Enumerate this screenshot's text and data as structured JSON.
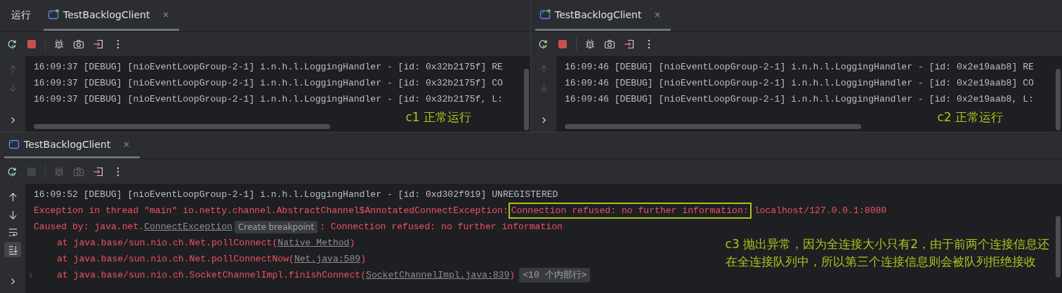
{
  "panels": [
    {
      "kind": "split",
      "run_label": "运行",
      "tab": {
        "title": "TestBacklogClient",
        "selected": true,
        "running": true
      },
      "toolbar": [
        {
          "kind": "rerun",
          "disabled": false
        },
        {
          "kind": "stop",
          "disabled": false
        },
        {
          "kind": "debug",
          "disabled": false
        },
        {
          "kind": "camera",
          "disabled": false
        },
        {
          "kind": "exit",
          "disabled": false
        },
        {
          "kind": "more",
          "disabled": false
        }
      ],
      "gutter": [
        {
          "kind": "up",
          "disabled": true
        },
        {
          "kind": "down",
          "disabled": true
        },
        {
          "kind": "chevron",
          "disabled": false,
          "selected": false
        }
      ],
      "lines": [
        {
          "kind": "debug",
          "segments": [
            {
              "kind": "text",
              "text": "16:09:37 [DEBUG] [nioEventLoopGroup-2-1] i.n.h.l.LoggingHandler - [id: 0x32b2175f] RE"
            }
          ]
        },
        {
          "kind": "debug",
          "segments": [
            {
              "kind": "text",
              "text": "16:09:37 [DEBUG] [nioEventLoopGroup-2-1] i.n.h.l.LoggingHandler - [id: 0x32b2175f] CO"
            }
          ]
        },
        {
          "kind": "debug",
          "segments": [
            {
              "kind": "text",
              "text": "16:09:37 [DEBUG] [nioEventLoopGroup-2-1] i.n.h.l.LoggingHandler - [id: 0x32b2175f, L:"
            }
          ]
        }
      ],
      "annotation": [
        "c1 正常运行"
      ]
    },
    {
      "kind": "split",
      "tab": {
        "title": "TestBacklogClient",
        "selected": true,
        "running": true
      },
      "toolbar": [
        {
          "kind": "rerun",
          "disabled": false
        },
        {
          "kind": "stop",
          "disabled": false
        },
        {
          "kind": "debug",
          "disabled": false
        },
        {
          "kind": "camera",
          "disabled": false
        },
        {
          "kind": "exit",
          "disabled": false
        },
        {
          "kind": "more",
          "disabled": false
        }
      ],
      "gutter": [
        {
          "kind": "up",
          "disabled": true
        },
        {
          "kind": "down",
          "disabled": true
        },
        {
          "kind": "chevron",
          "disabled": false,
          "selected": false
        }
      ],
      "lines": [
        {
          "kind": "debug",
          "segments": [
            {
              "kind": "text",
              "text": "16:09:46 [DEBUG] [nioEventLoopGroup-2-1] i.n.h.l.LoggingHandler - [id: 0x2e19aab8] RE"
            }
          ]
        },
        {
          "kind": "debug",
          "segments": [
            {
              "kind": "text",
              "text": "16:09:46 [DEBUG] [nioEventLoopGroup-2-1] i.n.h.l.LoggingHandler - [id: 0x2e19aab8] CO"
            }
          ]
        },
        {
          "kind": "debug",
          "segments": [
            {
              "kind": "text",
              "text": "16:09:46 [DEBUG] [nioEventLoopGroup-2-1] i.n.h.l.LoggingHandler - [id: 0x2e19aab8, L:"
            }
          ]
        }
      ],
      "annotation": [
        "c2 正常运行"
      ]
    },
    {
      "kind": "full",
      "tab": {
        "title": "TestBacklogClient",
        "selected": true,
        "running": false
      },
      "toolbar": [
        {
          "kind": "rerun",
          "disabled": false
        },
        {
          "kind": "stop",
          "disabled": true
        },
        {
          "kind": "debug",
          "disabled": true
        },
        {
          "kind": "camera",
          "disabled": true
        },
        {
          "kind": "exit",
          "disabled": false
        },
        {
          "kind": "more",
          "disabled": false
        }
      ],
      "gutter": [
        {
          "kind": "up",
          "disabled": false
        },
        {
          "kind": "down",
          "disabled": false
        },
        {
          "kind": "wrap",
          "disabled": false,
          "selected": false
        },
        {
          "kind": "scroll-end",
          "disabled": false,
          "selected": true
        },
        {
          "kind": "chevron",
          "disabled": false,
          "selected": false
        }
      ],
      "lines": [
        {
          "kind": "debug",
          "segments": [
            {
              "kind": "text",
              "text": "16:09:52 [DEBUG] [nioEventLoopGroup-2-1] i.n.h.l.LoggingHandler - [id: 0xd302f919] UNREGISTERED"
            }
          ]
        },
        {
          "kind": "error",
          "segments": [
            {
              "kind": "text",
              "text": "Exception in thread \"main\" io.netty.channel.AbstractChannel$AnnotatedConnectException:"
            },
            {
              "kind": "boxed",
              "text": "Connection refused: no further information:"
            },
            {
              "kind": "text",
              "text": "localhost/127.0.0.1:8080"
            }
          ]
        },
        {
          "kind": "error",
          "segments": [
            {
              "kind": "text",
              "text": "Caused by: java.net."
            },
            {
              "kind": "link",
              "text": "ConnectException"
            },
            {
              "kind": "chip",
              "text": "Create breakpoint"
            },
            {
              "kind": "text",
              "text": ": Connection refused: no further information"
            }
          ]
        },
        {
          "kind": "trace",
          "segments": [
            {
              "kind": "text",
              "text": "at java.base/sun.nio.ch.Net.pollConnect("
            },
            {
              "kind": "link",
              "text": "Native Method"
            },
            {
              "kind": "text",
              "text": ")"
            }
          ]
        },
        {
          "kind": "trace",
          "segments": [
            {
              "kind": "text",
              "text": "at java.base/sun.nio.ch.Net.pollConnectNow("
            },
            {
              "kind": "link",
              "text": "Net.java:589"
            },
            {
              "kind": "text",
              "text": ")"
            }
          ]
        },
        {
          "kind": "trace",
          "foldable": true,
          "segments": [
            {
              "kind": "text",
              "text": "at java.base/sun.nio.ch.SocketChannelImpl.finishConnect("
            },
            {
              "kind": "link",
              "text": "SocketChannelImpl.java:839"
            },
            {
              "kind": "text",
              "text": ")"
            },
            {
              "kind": "chip",
              "text": "<10 个内部行>"
            }
          ]
        }
      ],
      "annotation": [
        "c3 抛出异常，因为全连接大小只有2，由于前两个连接信息还",
        "在全连接队列中，所以第三个连接信息则会被队列拒绝接收"
      ]
    }
  ]
}
